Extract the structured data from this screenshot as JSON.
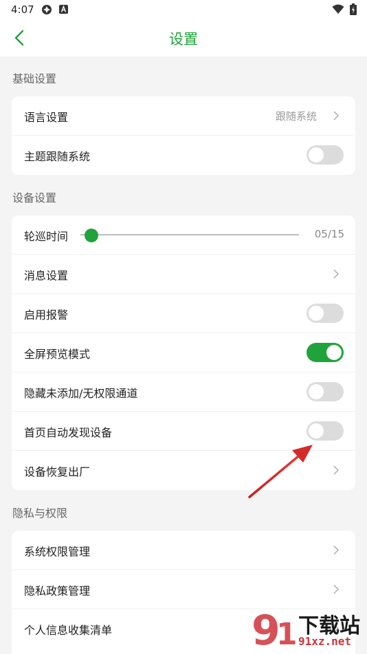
{
  "status_bar": {
    "time": "4:07",
    "icons": [
      "settings-app-icon",
      "a-notification-icon",
      "wifi-icon",
      "battery-icon"
    ]
  },
  "header": {
    "title": "设置",
    "back_icon": "chevron-left-icon"
  },
  "colors": {
    "accent": "#1fa33a",
    "background": "#f4f4f4",
    "toggle_off": "#dcdcdc",
    "annotation_arrow": "#d42a2a"
  },
  "sections": [
    {
      "title": "基础设置",
      "rows": [
        {
          "label": "语言设置",
          "value": "跟随系统",
          "control": "chevron"
        },
        {
          "label": "主题跟随系统",
          "control": "toggle",
          "on": false
        }
      ]
    },
    {
      "title": "设备设置",
      "rows": [
        {
          "label": "轮巡时间",
          "control": "slider",
          "value": "05/15",
          "level": 0.0
        },
        {
          "label": "消息设置",
          "control": "chevron"
        },
        {
          "label": "启用报警",
          "control": "toggle",
          "on": false
        },
        {
          "label": "全屏预览模式",
          "control": "toggle",
          "on": true
        },
        {
          "label": "隐藏未添加/无权限通道",
          "control": "toggle",
          "on": false
        },
        {
          "label": "首页自动发现设备",
          "control": "toggle",
          "on": false
        },
        {
          "label": "设备恢复出厂",
          "control": "chevron"
        }
      ]
    },
    {
      "title": "隐私与权限",
      "rows": [
        {
          "label": "系统权限管理",
          "control": "chevron"
        },
        {
          "label": "隐私政策管理",
          "control": "chevron"
        },
        {
          "label": "个人信息收集清单",
          "control": "chevron"
        }
      ]
    }
  ],
  "watermark": {
    "text_main": "下载站",
    "text_url": "91xz.net"
  }
}
